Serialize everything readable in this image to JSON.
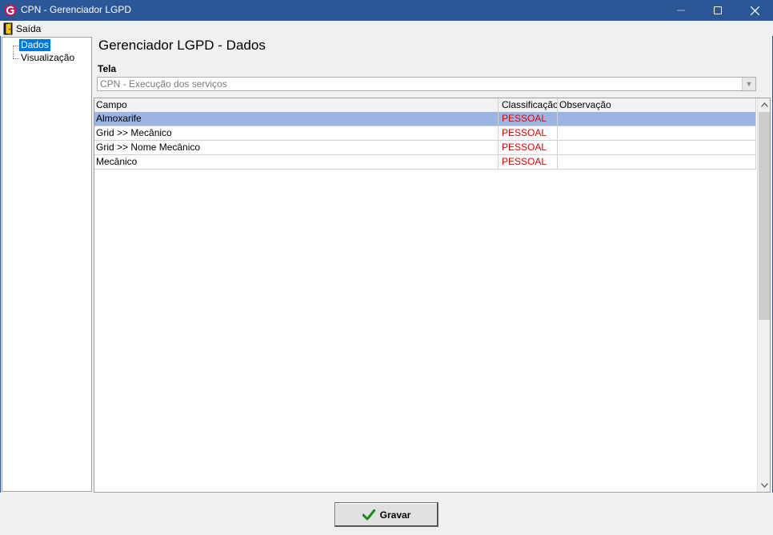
{
  "window": {
    "title": "CPN - Gerenciador LGPD",
    "icon": "cpn-logo-icon"
  },
  "menu": {
    "items": [
      {
        "label": "Saída",
        "icon": "exit-door-icon"
      }
    ]
  },
  "tree": {
    "items": [
      {
        "label": "Dados",
        "selected": true
      },
      {
        "label": "Visualização",
        "selected": false
      }
    ]
  },
  "main": {
    "title": "Gerenciador LGPD - Dados",
    "tela_label": "Tela",
    "tela_value": "CPN - Execução dos serviços"
  },
  "grid": {
    "columns": [
      "Campo",
      "Classificação",
      "Observação"
    ],
    "rows": [
      {
        "campo": "Almoxarife",
        "classificacao": "PESSOAL",
        "observacao": "",
        "selected": true
      },
      {
        "campo": "Grid >> Mecânico",
        "classificacao": "PESSOAL",
        "observacao": ""
      },
      {
        "campo": "Grid >> Nome Mecânico",
        "classificacao": "PESSOAL",
        "observacao": ""
      },
      {
        "campo": "Mecânico",
        "classificacao": "PESSOAL",
        "observacao": ""
      }
    ]
  },
  "footer": {
    "save_label": "Gravar",
    "save_icon": "checkmark-icon"
  },
  "colors": {
    "titlebar": "#2b5797",
    "selection": "#9cb4e4",
    "classification_text": "#e00000",
    "tree_selection": "#0078d7"
  }
}
